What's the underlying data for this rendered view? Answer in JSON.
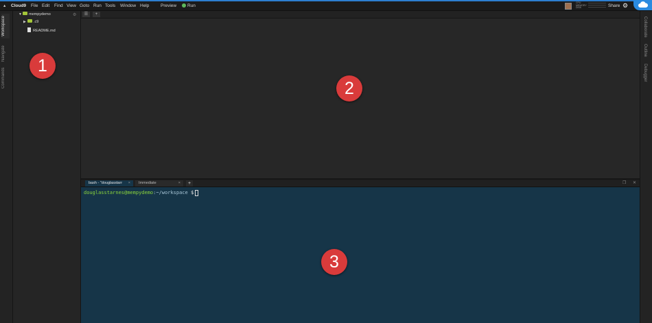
{
  "menubar": {
    "brand": "Cloud9",
    "items": [
      "File",
      "Edit",
      "Find",
      "View",
      "Goto",
      "Run",
      "Tools",
      "Window",
      "Help"
    ],
    "preview": "Preview",
    "run": "Run",
    "share": "Share",
    "stats": [
      "CPU",
      "MEMORY",
      "DISK"
    ]
  },
  "left_panels": [
    "Workspace",
    "Navigate",
    "Commands"
  ],
  "right_panels": [
    "Collaborate",
    "Outline",
    "Debugger"
  ],
  "tree": {
    "root": "mempydemo",
    "children": [
      {
        "name": ".c9",
        "type": "folder"
      },
      {
        "name": "README.md",
        "type": "file"
      }
    ]
  },
  "editor": {
    "plus_label": "+"
  },
  "terminal": {
    "tabs": [
      {
        "label": "bash - \"douglasstarr",
        "close": "×"
      },
      {
        "label": "Immediate",
        "close": "×"
      }
    ],
    "plus_label": "+",
    "prompt_user": "douglasstarnes@mempydemo",
    "prompt_path": ":~/workspace",
    "prompt_symbol": " $"
  },
  "callouts": [
    "1",
    "2",
    "3"
  ],
  "colors": {
    "accent": "#2d7fd1",
    "terminal_bg": "#163548",
    "callout": "#d93b3b",
    "folder": "#a4c639"
  }
}
